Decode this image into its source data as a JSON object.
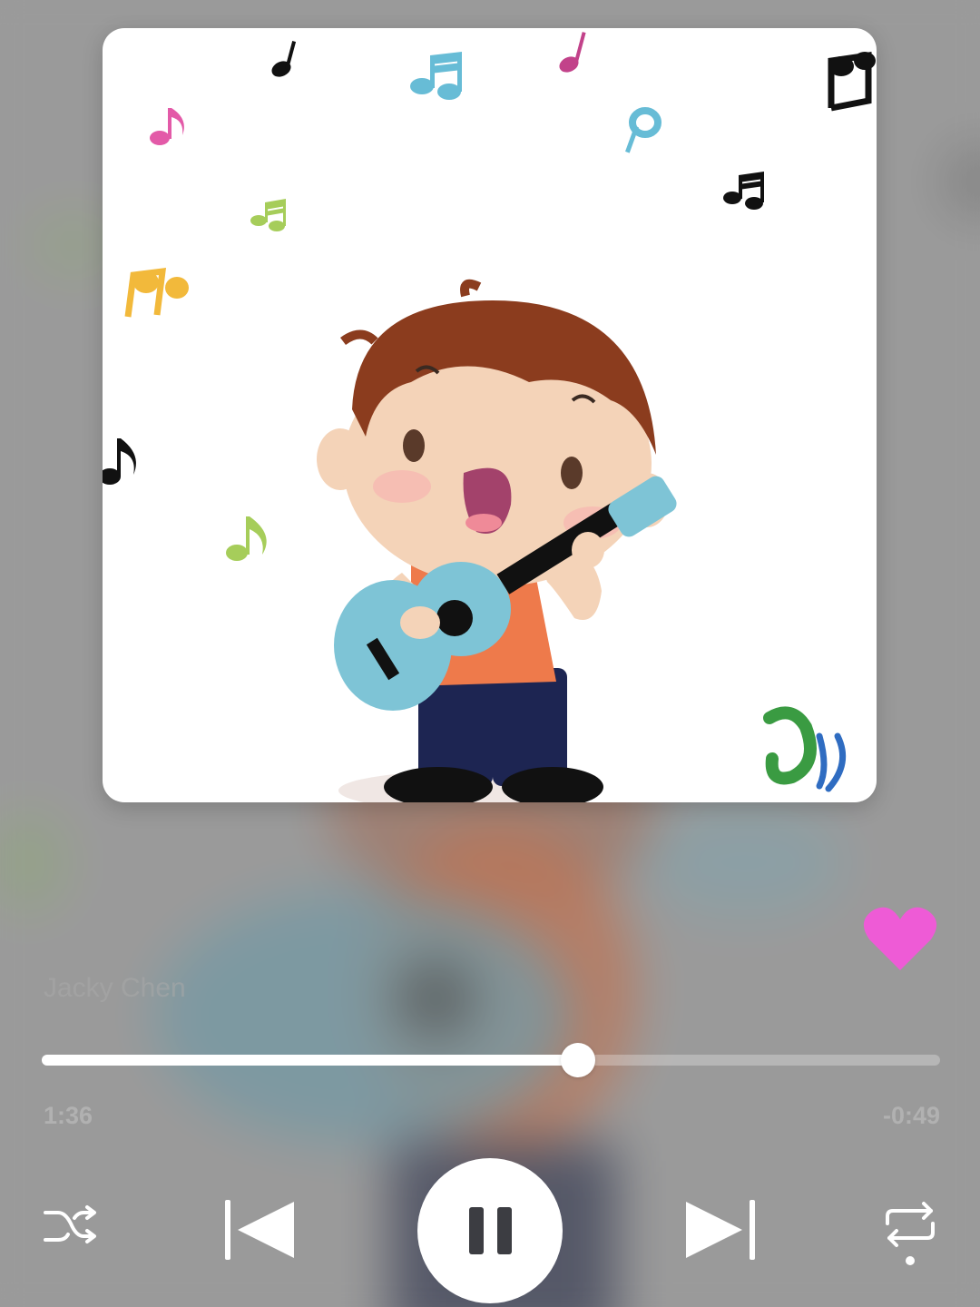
{
  "player": {
    "song_subtitle": "Jacky Chen",
    "progress_fraction": 0.597,
    "elapsed": "1:36",
    "remaining": "-0:49",
    "favorited": true
  },
  "colors": {
    "favorite": "#ee5bd6",
    "controls": "#ffffff",
    "pause_bars": "#3c3d42"
  },
  "controls": {
    "shuffle_icon": "shuffle-icon",
    "previous_icon": "skip-previous-icon",
    "play_pause_icon": "pause-icon",
    "next_icon": "skip-next-icon",
    "repeat_icon": "repeat-icon"
  }
}
